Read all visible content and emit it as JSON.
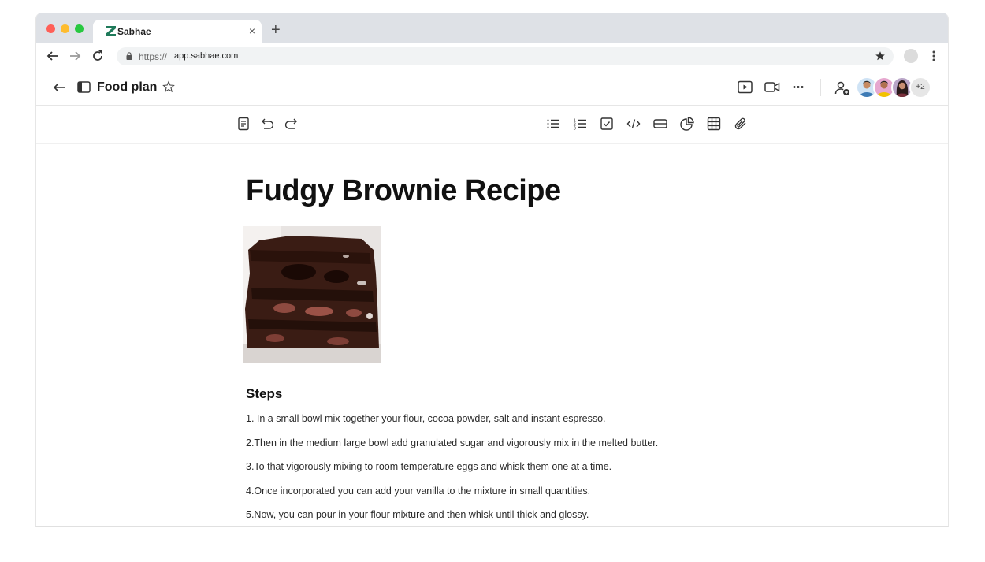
{
  "browser": {
    "tab_title": "Sabhae",
    "tab_close": "×",
    "new_tab": "+",
    "url_prefix": "https://",
    "url_host": "app.sabhae.com"
  },
  "header": {
    "title": "Food plan",
    "avatars_more": "+2"
  },
  "document": {
    "title": "Fudgy Brownie Recipe",
    "steps_heading": "Steps",
    "steps": [
      "1. In a small bowl mix together your flour, cocoa powder, salt and instant espresso.",
      "2.Then in the medium large bowl add granulated sugar and vigorously mix in the melted butter.",
      "3.To that vigorously mixing to room temperature eggs and whisk them one at a time.",
      "4.Once incorporated you can add your vanilla to the mixture in small quantities.",
      "5.Now, you can pour in your flour mixture and then whisk until thick and glossy."
    ]
  },
  "colors": {
    "brand": "#1f7a5a",
    "tab_bar": "#dee1e6",
    "omnibox": "#f1f3f4"
  },
  "icons": {
    "toolbar": [
      "page-icon",
      "undo-icon",
      "redo-icon",
      "bullet-list-icon",
      "numbered-list-icon",
      "checkbox-icon",
      "code-icon",
      "divider-block-icon",
      "chart-icon",
      "table-icon",
      "attachment-icon"
    ],
    "header": [
      "back-arrow-icon",
      "sidebar-toggle-icon",
      "star-outline-icon",
      "present-icon",
      "video-call-icon",
      "more-icon",
      "add-member-icon"
    ]
  }
}
